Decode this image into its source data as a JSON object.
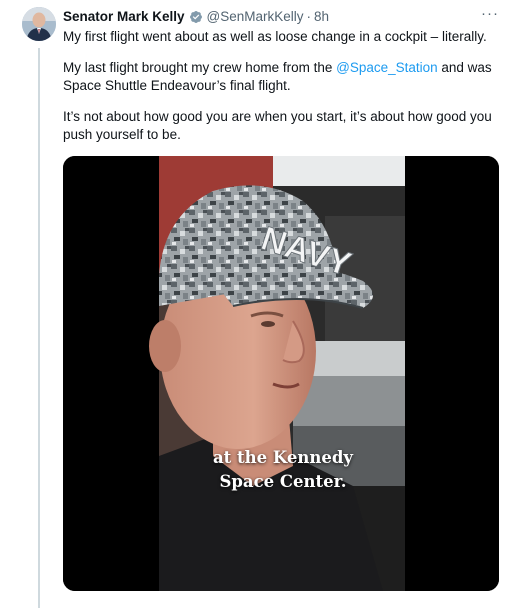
{
  "tweet": {
    "author_name": "Senator Mark Kelly",
    "handle": "@SenMarkKelly",
    "separator": "·",
    "time": "8h",
    "more_label": "···",
    "paragraph1": "My first flight went about as well as loose change in a cockpit – literally.",
    "paragraph2_before": "My last flight brought my crew home from the ",
    "paragraph2_mention": "@Space_Station",
    "paragraph2_after": " and was Space Shuttle Endeavour’s final flight.",
    "paragraph3": "It’s not about how good you are when you start, it’s about how good you push yourself to be."
  },
  "media": {
    "caption_line1": "at the Kennedy",
    "caption_line2": "Space Center.",
    "cap_text": "NAVY"
  },
  "colors": {
    "link": "#1d9bf0",
    "verified": "#1d9bf0",
    "secondary_text": "#536471"
  }
}
